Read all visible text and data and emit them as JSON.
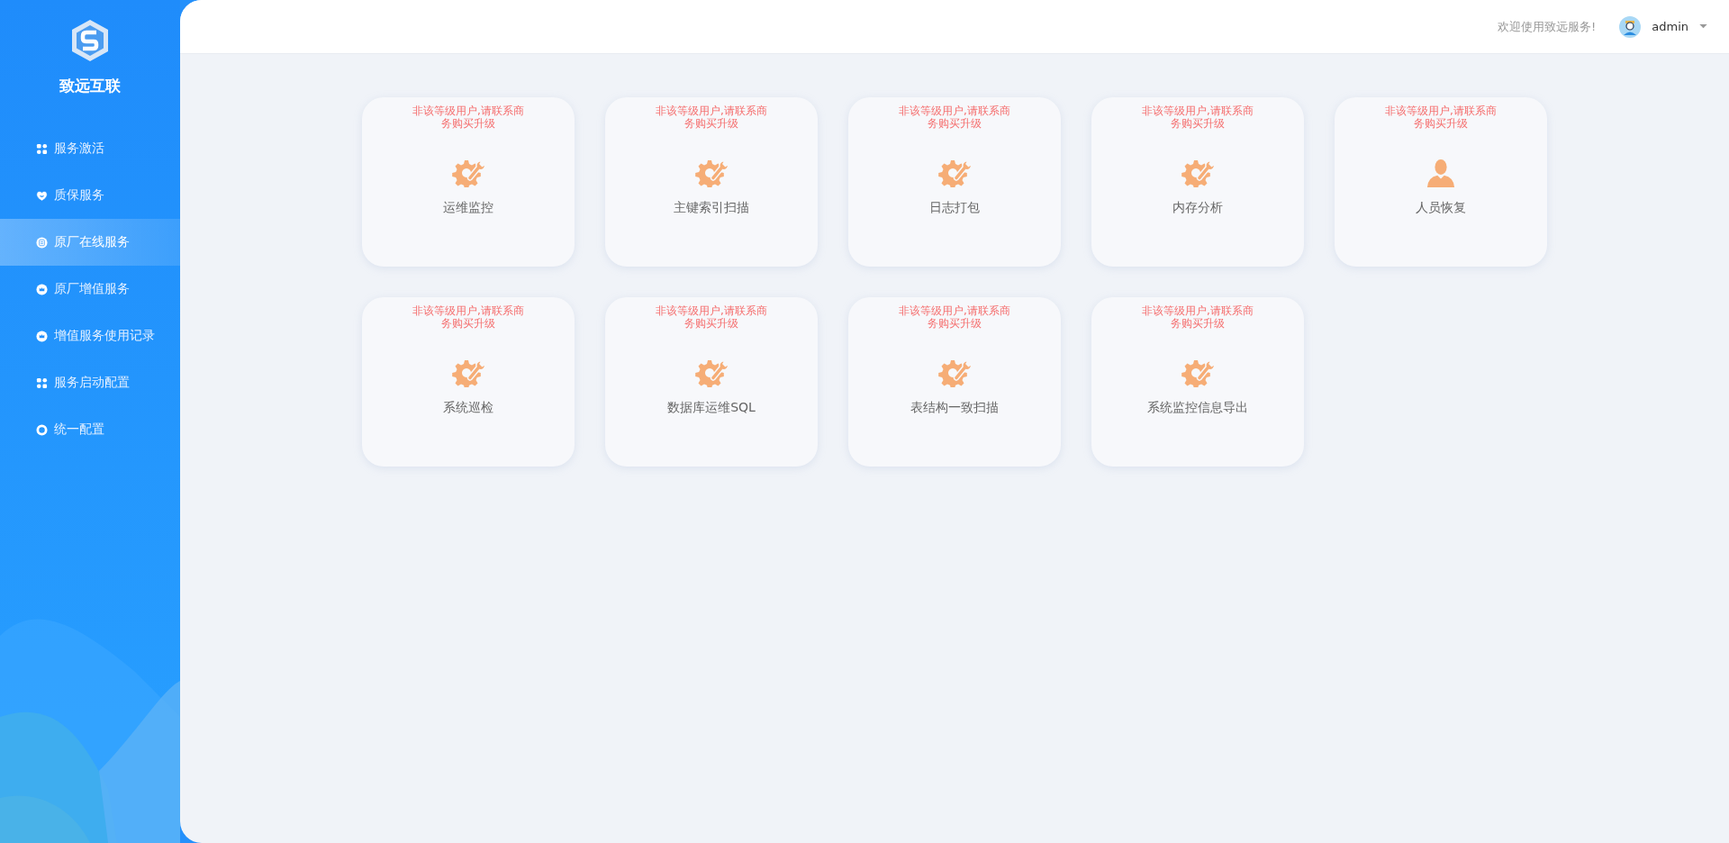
{
  "brand": {
    "name": "致远互联"
  },
  "sidebar": {
    "items": [
      {
        "label": "服务激活",
        "kind": "grid",
        "selected": false
      },
      {
        "label": "质保服务",
        "kind": "heart",
        "selected": false
      },
      {
        "label": "原厂在线服务",
        "kind": "list",
        "selected": true
      },
      {
        "label": "原厂增值服务",
        "kind": "crown",
        "selected": false
      },
      {
        "label": "增值服务使用记录",
        "kind": "crown",
        "selected": false
      },
      {
        "label": "服务启动配置",
        "kind": "grid",
        "selected": false
      },
      {
        "label": "统一配置",
        "kind": "ring",
        "selected": false
      }
    ]
  },
  "header": {
    "welcome": "欢迎使用致远服务!",
    "user": "admin"
  },
  "cards": [
    {
      "notice": "非该等级用户,请联系商务购买升级",
      "kind": "tools",
      "title": "运维监控"
    },
    {
      "notice": "非该等级用户,请联系商务购买升级",
      "kind": "tools",
      "title": "主键索引扫描"
    },
    {
      "notice": "非该等级用户,请联系商务购买升级",
      "kind": "tools",
      "title": "日志打包"
    },
    {
      "notice": "非该等级用户,请联系商务购买升级",
      "kind": "tools",
      "title": "内存分析"
    },
    {
      "notice": "非该等级用户,请联系商务购买升级",
      "kind": "person",
      "title": "人员恢复"
    },
    {
      "notice": "非该等级用户,请联系商务购买升级",
      "kind": "tools",
      "title": "系统巡检"
    },
    {
      "notice": "非该等级用户,请联系商务购买升级",
      "kind": "tools",
      "title": "数据库运维SQL"
    },
    {
      "notice": "非该等级用户,请联系商务购买升级",
      "kind": "tools",
      "title": "表结构一致扫描"
    },
    {
      "notice": "非该等级用户,请联系商务购买升级",
      "kind": "tools",
      "title": "系统监控信息导出"
    }
  ]
}
